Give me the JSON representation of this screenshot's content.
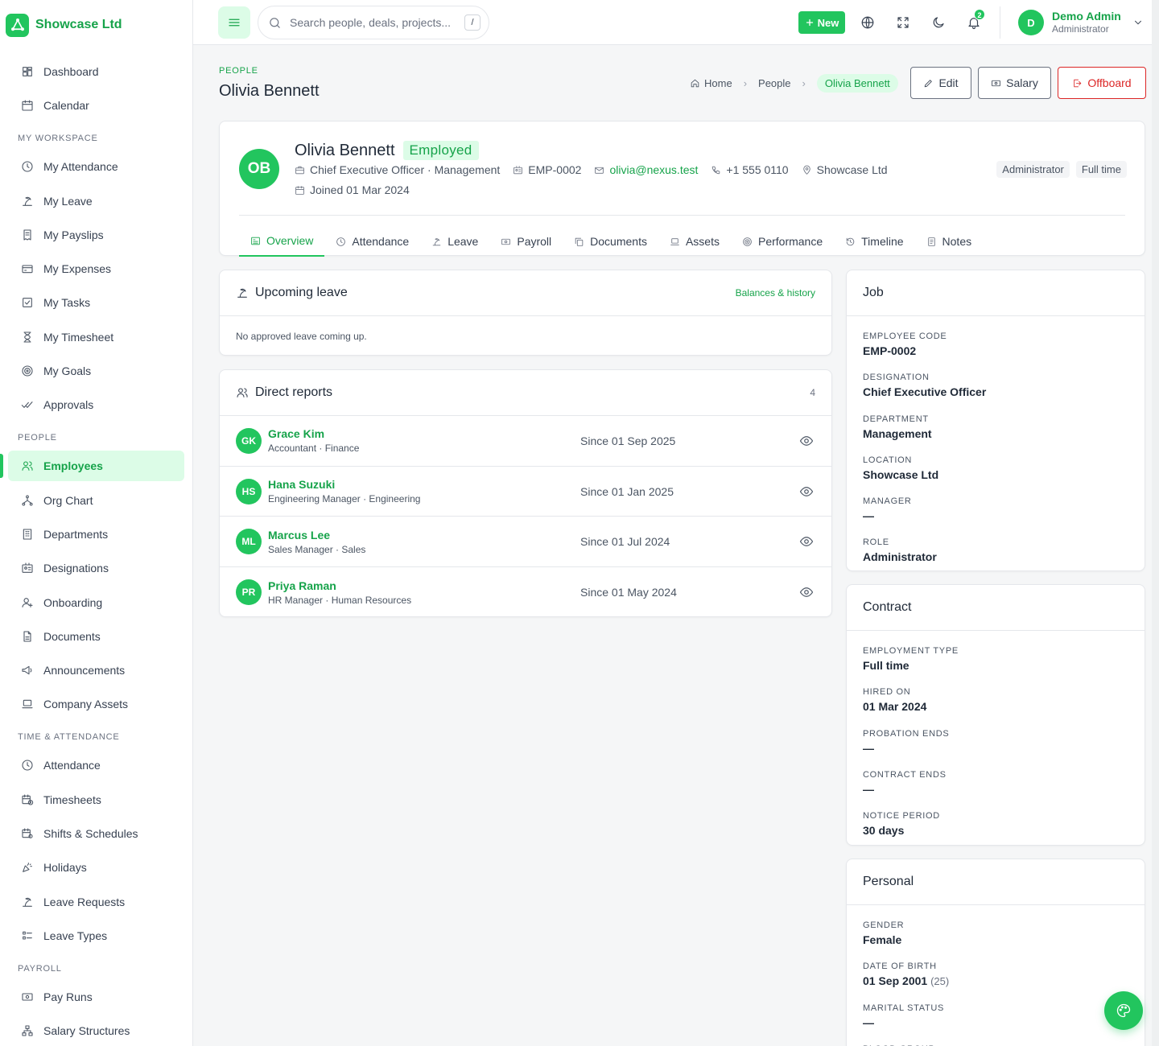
{
  "brand": {
    "name": "Showcase Ltd"
  },
  "sidebar": {
    "top": [
      {
        "label": "Dashboard",
        "icon": "dashboard-icon"
      },
      {
        "label": "Calendar",
        "icon": "calendar-icon"
      }
    ],
    "sections": [
      {
        "title": "MY WORKSPACE",
        "items": [
          {
            "label": "My Attendance",
            "icon": "clock-icon"
          },
          {
            "label": "My Leave",
            "icon": "beach-icon"
          },
          {
            "label": "My Payslips",
            "icon": "receipt-icon"
          },
          {
            "label": "My Expenses",
            "icon": "card-icon"
          },
          {
            "label": "My Tasks",
            "icon": "checkbox-icon"
          },
          {
            "label": "My Timesheet",
            "icon": "hourglass-icon"
          },
          {
            "label": "My Goals",
            "icon": "target-icon"
          },
          {
            "label": "Approvals",
            "icon": "double-check-icon"
          }
        ]
      },
      {
        "title": "PEOPLE",
        "items": [
          {
            "label": "Employees",
            "icon": "users-icon",
            "active": true
          },
          {
            "label": "Org Chart",
            "icon": "hierarchy-icon"
          },
          {
            "label": "Departments",
            "icon": "building-icon"
          },
          {
            "label": "Designations",
            "icon": "badge-icon"
          },
          {
            "label": "Onboarding",
            "icon": "user-plus-icon"
          },
          {
            "label": "Documents",
            "icon": "document-icon"
          },
          {
            "label": "Announcements",
            "icon": "megaphone-icon"
          },
          {
            "label": "Company Assets",
            "icon": "laptop-icon"
          }
        ]
      },
      {
        "title": "TIME & ATTENDANCE",
        "items": [
          {
            "label": "Attendance",
            "icon": "clock-icon"
          },
          {
            "label": "Timesheets",
            "icon": "calendar-clock-icon"
          },
          {
            "label": "Shifts & Schedules",
            "icon": "calendar-gear-icon"
          },
          {
            "label": "Holidays",
            "icon": "confetti-icon"
          },
          {
            "label": "Leave Requests",
            "icon": "beach-icon"
          },
          {
            "label": "Leave Types",
            "icon": "list-icon"
          }
        ]
      },
      {
        "title": "PAYROLL",
        "items": [
          {
            "label": "Pay Runs",
            "icon": "cash-icon"
          },
          {
            "label": "Salary Structures",
            "icon": "structure-icon"
          }
        ]
      }
    ]
  },
  "topbar": {
    "search_placeholder": "Search people, deals, projects...",
    "search_shortcut": "/",
    "new_label": "New",
    "notifications_count": "2",
    "user_name": "Demo Admin",
    "user_role": "Administrator",
    "user_initial": "D"
  },
  "page": {
    "pretitle": "PEOPLE",
    "title": "Olivia Bennett",
    "breadcrumb": {
      "home": "Home",
      "section": "People",
      "current": "Olivia Bennett"
    },
    "actions": {
      "edit": "Edit",
      "salary": "Salary",
      "offboard": "Offboard"
    }
  },
  "profile": {
    "initials": "OB",
    "name": "Olivia Bennett",
    "status": "Employed",
    "title_dept": "Chief Executive Officer · Management",
    "code": "EMP-0002",
    "email": "olivia@nexus.test",
    "phone": "+1 555 0110",
    "location": "Showcase Ltd",
    "joined": "Joined 01 Mar 2024",
    "tags": [
      "Administrator",
      "Full time"
    ]
  },
  "tabs": [
    {
      "label": "Overview",
      "icon": "overview-icon",
      "active": true
    },
    {
      "label": "Attendance",
      "icon": "clock-icon"
    },
    {
      "label": "Leave",
      "icon": "beach-icon"
    },
    {
      "label": "Payroll",
      "icon": "cash-icon"
    },
    {
      "label": "Documents",
      "icon": "copy-icon"
    },
    {
      "label": "Assets",
      "icon": "laptop-icon"
    },
    {
      "label": "Performance",
      "icon": "target-icon"
    },
    {
      "label": "Timeline",
      "icon": "history-icon"
    },
    {
      "label": "Notes",
      "icon": "note-icon"
    }
  ],
  "upcoming_leave": {
    "title": "Upcoming leave",
    "link": "Balances & history",
    "empty": "No approved leave coming up."
  },
  "direct_reports": {
    "title": "Direct reports",
    "count": "4",
    "rows": [
      {
        "initials": "GK",
        "name": "Grace Kim",
        "sub": "Accountant · Finance",
        "since": "Since 01 Sep 2025"
      },
      {
        "initials": "HS",
        "name": "Hana Suzuki",
        "sub": "Engineering Manager · Engineering",
        "since": "Since 01 Jan 2025"
      },
      {
        "initials": "ML",
        "name": "Marcus Lee",
        "sub": "Sales Manager · Sales",
        "since": "Since 01 Jul 2024"
      },
      {
        "initials": "PR",
        "name": "Priya Raman",
        "sub": "HR Manager · Human Resources",
        "since": "Since 01 May 2024"
      }
    ]
  },
  "job": {
    "title": "Job",
    "fields": [
      {
        "label": "EMPLOYEE CODE",
        "value": "EMP-0002"
      },
      {
        "label": "DESIGNATION",
        "value": "Chief Executive Officer"
      },
      {
        "label": "DEPARTMENT",
        "value": "Management"
      },
      {
        "label": "LOCATION",
        "value": "Showcase Ltd"
      },
      {
        "label": "MANAGER",
        "value": "—"
      },
      {
        "label": "ROLE",
        "value": "Administrator"
      }
    ]
  },
  "contract": {
    "title": "Contract",
    "fields": [
      {
        "label": "EMPLOYMENT TYPE",
        "value": "Full time"
      },
      {
        "label": "HIRED ON",
        "value": "01 Mar 2024"
      },
      {
        "label": "PROBATION ENDS",
        "value": "—"
      },
      {
        "label": "CONTRACT ENDS",
        "value": "—"
      },
      {
        "label": "NOTICE PERIOD",
        "value": "30 days"
      }
    ]
  },
  "personal": {
    "title": "Personal",
    "fields": [
      {
        "label": "GENDER",
        "value": "Female"
      },
      {
        "label": "DATE OF BIRTH",
        "value": "01 Sep 2001",
        "extra": "(25)"
      },
      {
        "label": "MARITAL STATUS",
        "value": "—"
      },
      {
        "label": "BLOOD GROUP",
        "value": ""
      }
    ]
  },
  "colors": {
    "accent": "#22c55e",
    "accent_dark": "#16a34a",
    "accent_soft": "#dcfce7",
    "danger": "#dc2626"
  }
}
